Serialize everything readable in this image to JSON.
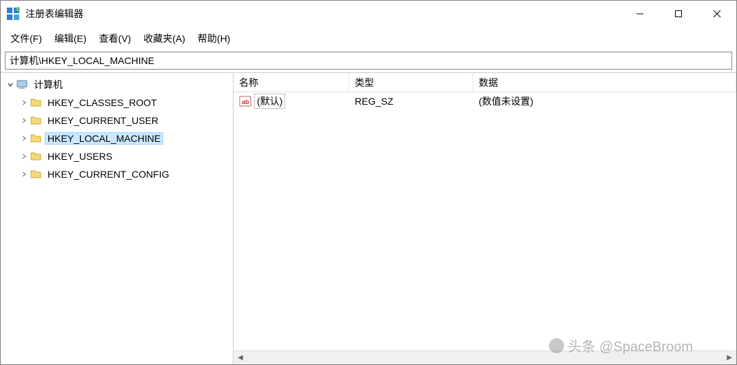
{
  "titlebar": {
    "title": "注册表编辑器"
  },
  "menubar": {
    "file": "文件(F)",
    "edit": "编辑(E)",
    "view": "查看(V)",
    "favorites": "收藏夹(A)",
    "help": "帮助(H)"
  },
  "address_bar": {
    "path": "计算机\\HKEY_LOCAL_MACHINE"
  },
  "tree": {
    "root": "计算机",
    "items": [
      {
        "label": "HKEY_CLASSES_ROOT"
      },
      {
        "label": "HKEY_CURRENT_USER"
      },
      {
        "label": "HKEY_LOCAL_MACHINE"
      },
      {
        "label": "HKEY_USERS"
      },
      {
        "label": "HKEY_CURRENT_CONFIG"
      }
    ]
  },
  "list": {
    "headers": {
      "name": "名称",
      "type": "类型",
      "data": "数据"
    },
    "rows": [
      {
        "name": "(默认)",
        "type": "REG_SZ",
        "data": "(数值未设置)"
      }
    ]
  },
  "watermark": {
    "text": "头条 @SpaceBroom"
  }
}
